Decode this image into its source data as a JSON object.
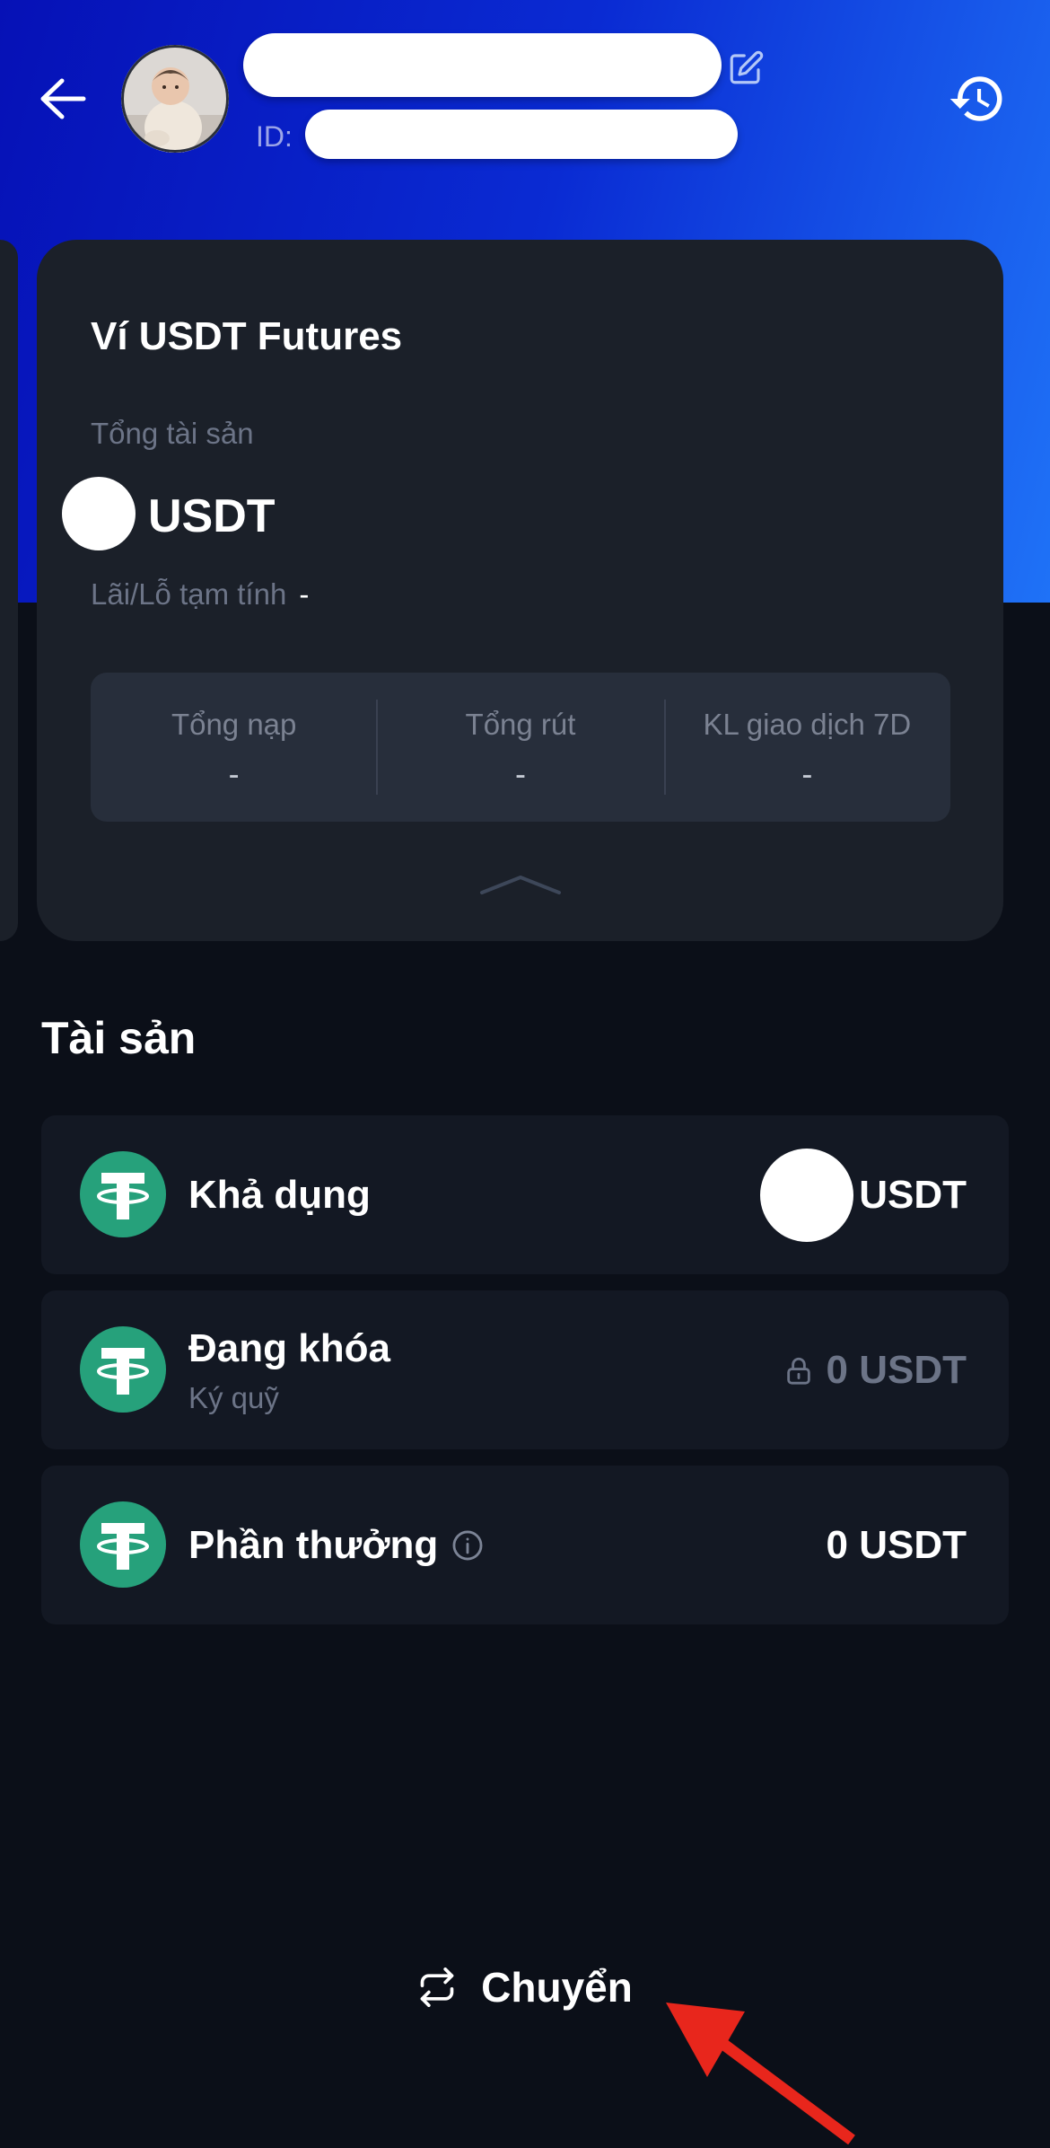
{
  "colors": {
    "page_background": "#0b0f18",
    "header_gradient_start": "#0611b6",
    "header_gradient_end": "#1f72f7",
    "card_background": "#1b2029",
    "stats_background": "#272e3b",
    "row_background": "#131823",
    "primary_button": "#1877fe",
    "muted_text": "#6c7487",
    "tether_green": "#26a17b",
    "annotation_arrow": "#e8261c"
  },
  "header": {
    "back_icon": "arrow-left-icon",
    "avatar": "avatar",
    "edit_icon": "edit-icon",
    "id_label": "ID:",
    "history_icon": "history-icon"
  },
  "wallet_card": {
    "title": "Ví USDT Futures",
    "total_assets_label": "Tổng tài sản",
    "total_assets_unit": "USDT",
    "pnl_label": "Lãi/Lỗ tạm tính",
    "pnl_value": "-",
    "stats": [
      {
        "label": "Tổng nạp",
        "value": "-"
      },
      {
        "label": "Tổng rút",
        "value": "-"
      },
      {
        "label": "KL giao dịch 7D",
        "value": "-"
      }
    ],
    "collapse_icon": "chevron-up-icon"
  },
  "assets": {
    "heading": "Tài sản",
    "rows": [
      {
        "icon": "tether-icon",
        "label": "Khả dụng",
        "value": "USDT"
      },
      {
        "icon": "tether-icon",
        "label": "Đang khóa",
        "sublabel": "Ký quỹ",
        "status_icon": "lock-icon",
        "value": "0 USDT"
      },
      {
        "icon": "tether-icon",
        "label": "Phần thưởng",
        "info_icon": "info-icon",
        "value": "0 USDT"
      }
    ]
  },
  "transfer_button": {
    "icon": "swap-icon",
    "label": "Chuyển"
  }
}
